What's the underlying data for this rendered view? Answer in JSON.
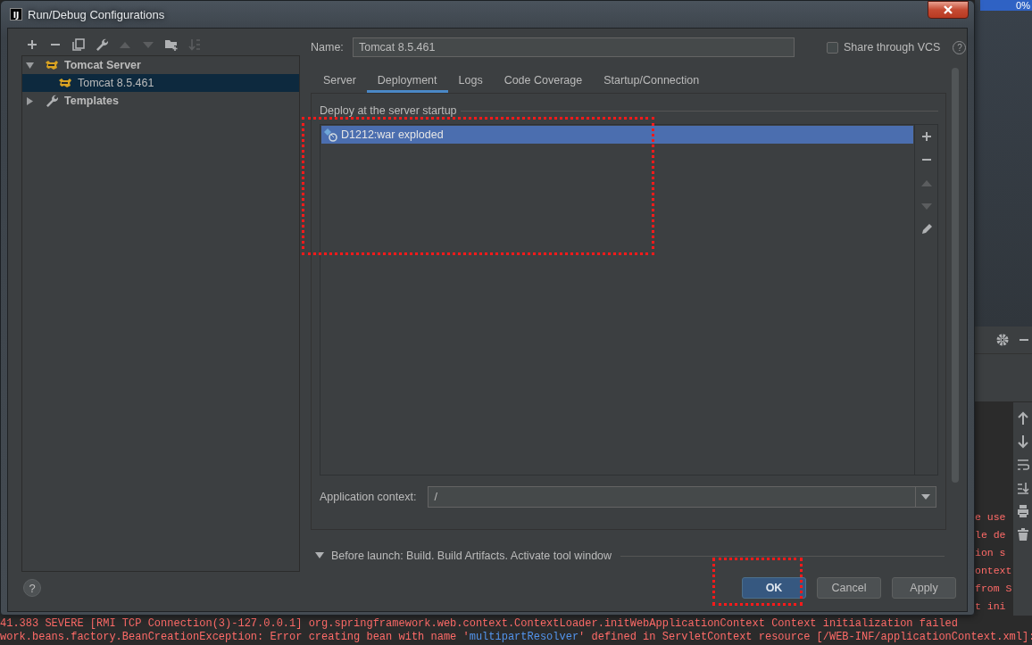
{
  "window": {
    "icon_text": "IJ",
    "title": "Run/Debug Configurations"
  },
  "toolbar": [
    {
      "kind": "add",
      "disabled": false
    },
    {
      "kind": "remove",
      "disabled": false
    },
    {
      "kind": "copy",
      "disabled": false
    },
    {
      "kind": "wrench",
      "disabled": false
    },
    {
      "kind": "move-up",
      "disabled": true
    },
    {
      "kind": "move-down",
      "disabled": true
    },
    {
      "kind": "new-folder",
      "disabled": false
    },
    {
      "kind": "sort",
      "disabled": true
    }
  ],
  "tree": [
    {
      "label": "Tomcat Server",
      "kind": "server",
      "expanded": true,
      "children": [
        {
          "label": "Tomcat 8.5.461",
          "kind": "server",
          "selected": true
        }
      ]
    },
    {
      "label": "Templates",
      "kind": "templates",
      "expanded": false
    }
  ],
  "name_field": {
    "label": "Name:",
    "value": "Tomcat 8.5.461"
  },
  "share": {
    "label": "Share through VCS",
    "checked": false,
    "help": "?"
  },
  "tabs": [
    {
      "label": "Server",
      "selected": false
    },
    {
      "label": "Deployment",
      "selected": true
    },
    {
      "label": "Logs",
      "selected": false
    },
    {
      "label": "Code Coverage",
      "selected": false
    },
    {
      "label": "Startup/Connection",
      "selected": false
    }
  ],
  "deployment": {
    "section_title": "Deploy at the server startup",
    "highlighted": true,
    "items": [
      {
        "label": "D1212:war exploded",
        "selected": true
      }
    ],
    "side_buttons": [
      {
        "kind": "add",
        "disabled": false
      },
      {
        "kind": "remove",
        "disabled": false
      },
      {
        "kind": "move-up",
        "disabled": true
      },
      {
        "kind": "move-down",
        "disabled": true
      },
      {
        "kind": "edit",
        "disabled": false
      }
    ]
  },
  "app_context": {
    "label": "Application context:",
    "value": "/"
  },
  "before_launch": {
    "label": "Before launch: Build. Build Artifacts. Activate tool window",
    "expanded": true
  },
  "help_button": "?",
  "buttons": [
    {
      "label": "OK",
      "default": true,
      "highlighted": true
    },
    {
      "label": "Cancel",
      "default": false,
      "highlighted": false
    },
    {
      "label": "Apply",
      "default": false,
      "highlighted": false
    }
  ],
  "background": {
    "progress": "0%",
    "console_fragments": [
      "e use",
      "le de",
      "ion s",
      "ontext",
      "from S",
      "t ini"
    ],
    "console_lines": [
      [
        {
          "text": "41.383 SEVERE [RMI TCP Connection(3)-127.0.0.1] org.springframework.web.context.ContextLoader.initWebApplicationContext Context initialization failed",
          "kind": "plain"
        }
      ],
      [
        {
          "text": "work.beans.factory.BeanCreationException: Error creating bean with name '",
          "kind": "plain"
        },
        {
          "text": "multipartResolver",
          "kind": "link"
        },
        {
          "text": "' defined in ServletContext resource [/WEB-INF/applicationContext.xml]:",
          "kind": "plain"
        }
      ]
    ]
  }
}
